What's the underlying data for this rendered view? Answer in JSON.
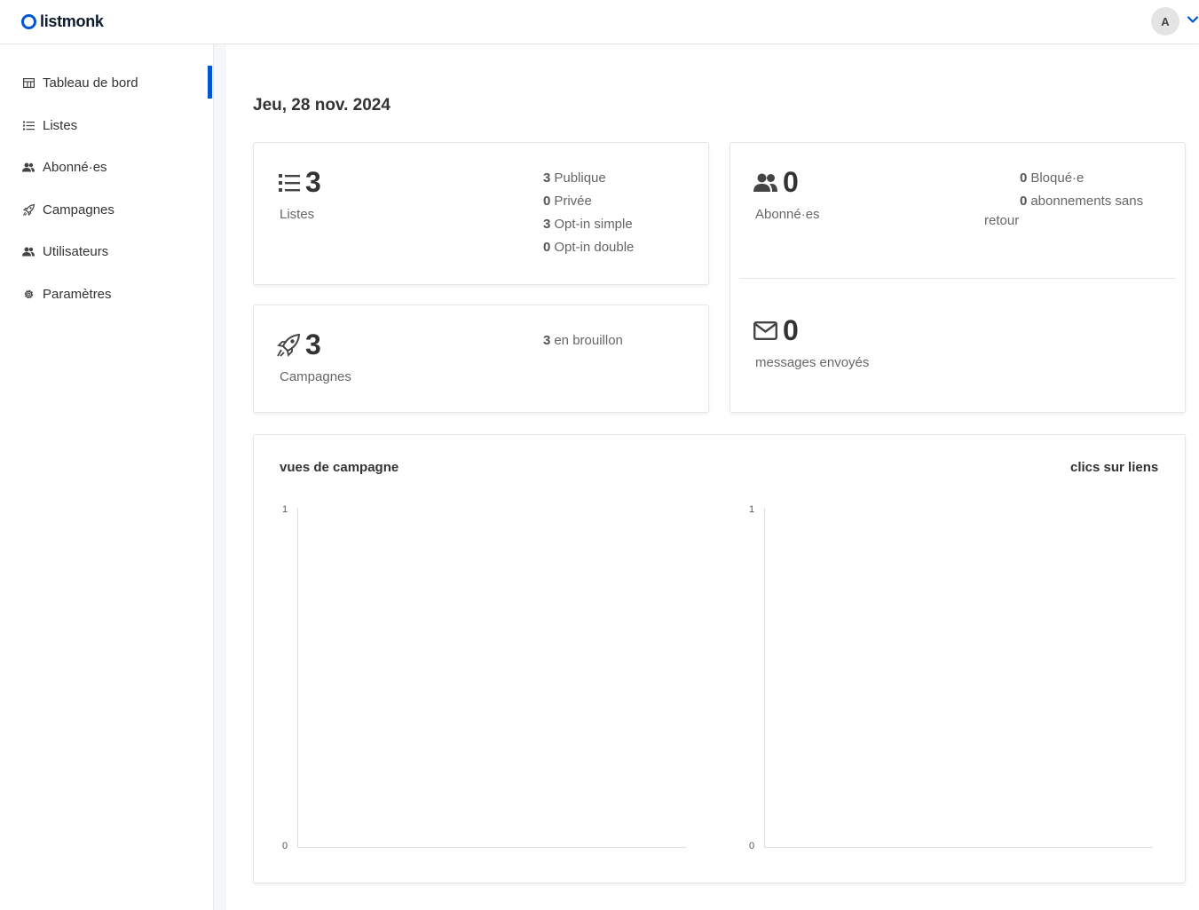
{
  "header": {
    "logo_text": "listmonk",
    "avatar_initial": "A"
  },
  "sidebar": {
    "items": [
      {
        "label": "Tableau de bord",
        "icon": "dashboard-icon",
        "active": true
      },
      {
        "label": "Listes",
        "icon": "list-icon"
      },
      {
        "label": "Abonné·es",
        "icon": "users-icon"
      },
      {
        "label": "Campagnes",
        "icon": "rocket-icon"
      },
      {
        "label": "Utilisateurs",
        "icon": "users-icon"
      },
      {
        "label": "Paramètres",
        "icon": "gear-icon"
      }
    ]
  },
  "main": {
    "date": "Jeu, 28 nov. 2024",
    "lists_card": {
      "count": "3",
      "label": "Listes",
      "stats": [
        {
          "value": "3",
          "label": "Publique"
        },
        {
          "value": "0",
          "label": "Privée"
        },
        {
          "value": "3",
          "label": "Opt-in simple"
        },
        {
          "value": "0",
          "label": "Opt-in double"
        }
      ]
    },
    "campaigns_card": {
      "count": "3",
      "label": "Campagnes",
      "stats": [
        {
          "value": "3",
          "label": "en brouillon"
        }
      ]
    },
    "subscribers_card": {
      "count": "0",
      "label": "Abonné·es",
      "stats": [
        {
          "value": "0",
          "label": "Bloqué·e"
        },
        {
          "value": "0",
          "label": "abonnements sans"
        }
      ],
      "stats_wrap": "retour",
      "messages_count": "0",
      "messages_label": "messages envoyés"
    },
    "charts": {
      "views_title": "vues de campagne",
      "clicks_title": "clics sur liens"
    }
  },
  "chart_data": [
    {
      "type": "line",
      "title": "vues de campagne",
      "series": [],
      "ylim": [
        0,
        1
      ],
      "y_ticks": [
        "1",
        "0"
      ]
    },
    {
      "type": "line",
      "title": "clics sur liens",
      "series": [],
      "ylim": [
        0,
        1
      ],
      "y_ticks": [
        "1",
        "0"
      ]
    }
  ],
  "colors": {
    "accent": "#0055d4",
    "text": "#444444",
    "border": "#e6e6e6"
  }
}
